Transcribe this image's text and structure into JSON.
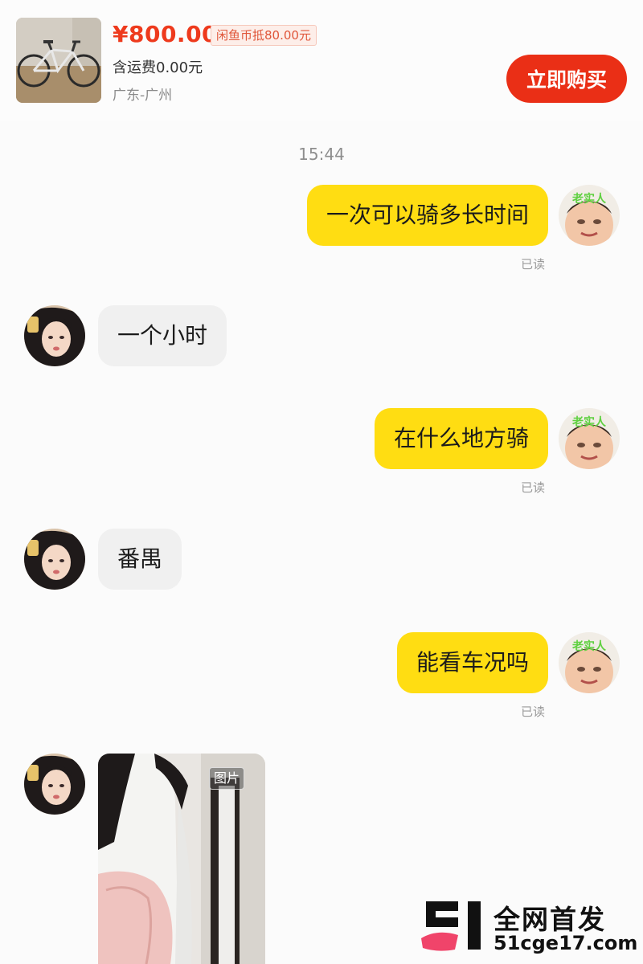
{
  "product": {
    "price": "¥800.00",
    "coin_offset": "闲鱼币抵80.00元",
    "shipping": "含运费0.00元",
    "location": "广东-广州",
    "buy_label": "立即购买"
  },
  "chat": {
    "timestamp": "15:44",
    "messages": [
      {
        "from": "me",
        "text": "一次可以骑多长时间",
        "status": "已读"
      },
      {
        "from": "other",
        "text": "一个小时"
      },
      {
        "from": "me",
        "text": "在什么地方骑",
        "status": "已读"
      },
      {
        "from": "other",
        "text": "番禺"
      },
      {
        "from": "me",
        "text": "能看车况吗",
        "status": "已读"
      },
      {
        "from": "other",
        "type": "image",
        "tag": "图片"
      }
    ],
    "my_avatar_caption": "老实人"
  },
  "watermark": {
    "title": "全网首发",
    "url": "51cge17.com"
  },
  "colors": {
    "accent_red": "#ea2f16",
    "price_red": "#ee3a1d",
    "my_bubble": "#ffdd12",
    "other_bubble": "#f0f0f0"
  },
  "icons": [
    "bicycle-thumbnail",
    "user-avatar-meme",
    "seller-avatar-girl",
    "watermark-logo-51"
  ]
}
